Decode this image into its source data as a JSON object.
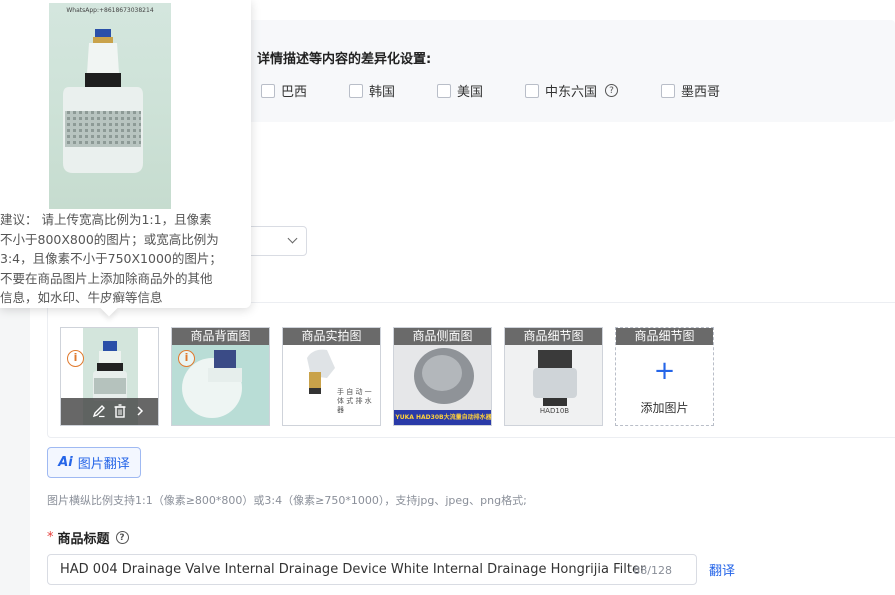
{
  "differentiation": {
    "title": "详情描述等内容的差异化设置:",
    "countries": [
      {
        "label": "巴西",
        "checked": false
      },
      {
        "label": "韩国",
        "checked": false
      },
      {
        "label": "美国",
        "checked": false
      },
      {
        "label": "中东六国",
        "checked": false,
        "help_icon": "help-icon"
      },
      {
        "label": "墨西哥",
        "checked": false
      }
    ],
    "help_glyph": "?"
  },
  "images": {
    "thumbnails": [
      {
        "label": "",
        "warning": true,
        "has_overlay": true
      },
      {
        "label": "商品背面图",
        "warning": true
      },
      {
        "label": "商品实拍图",
        "caption": "手 自 动 一 体 式 排 水 器"
      },
      {
        "label": "商品侧面图",
        "caption": "YUKA HAD30B大流量自动排水器"
      },
      {
        "label": "商品细节图",
        "caption": "HAD10B"
      },
      {
        "label": "商品细节图",
        "add": true
      }
    ],
    "add_plus": "+",
    "add_label": "添加图片",
    "warning_glyph": "i",
    "overlay_icons": [
      "edit-icon",
      "trash-icon",
      "chevron-right-icon"
    ],
    "translate_button": {
      "ai_glyph": "Ai",
      "label": "图片翻译"
    },
    "hint": "图片横纵比例支持1:1（像素≥800*800）或3:4（像素≥750*1000），支持jpg、jpeg、png格式;"
  },
  "title_field": {
    "required_mark": "*",
    "label": "商品标题",
    "value": "HAD 004 Drainage Valve Internal Drainage Device White Internal Drainage Hongrijia Filter",
    "count": "88/128",
    "translate_link": "翻译"
  },
  "tooltip": {
    "watermark": "WhatsApp:+8618673038214",
    "lines": [
      "建议： 请上传宽高比例为1:1，且像素",
      "不小于800X800的图片；或宽高比例为",
      "3:4，且像素不小于750X1000的图片；",
      "不要在商品图片上添加除商品外的其他",
      "信息，如水印、牛皮癣等信息"
    ]
  },
  "colors": {
    "accent": "#2565e8",
    "warning": "#e07a2e",
    "required": "#e53935",
    "label_bar": "#6a6a6a"
  }
}
